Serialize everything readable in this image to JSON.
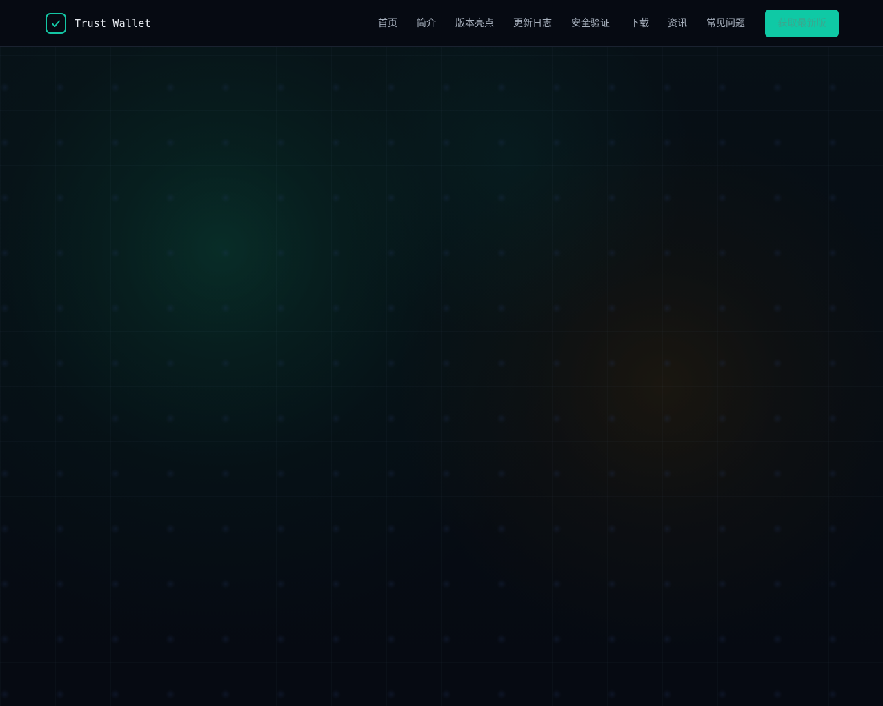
{
  "brand": {
    "name": "Trust Wallet",
    "logo_icon": "check-badge-icon"
  },
  "nav": {
    "items": [
      {
        "label": "首页"
      },
      {
        "label": "简介"
      },
      {
        "label": "版本亮点"
      },
      {
        "label": "更新日志"
      },
      {
        "label": "安全验证"
      },
      {
        "label": "下载"
      },
      {
        "label": "资讯"
      },
      {
        "label": "常见问题"
      }
    ]
  },
  "cta": {
    "label": "获取最新版"
  },
  "colors": {
    "accent": "#0fc9a5",
    "background": "#060a12",
    "nav_text": "#a7b0bd"
  }
}
